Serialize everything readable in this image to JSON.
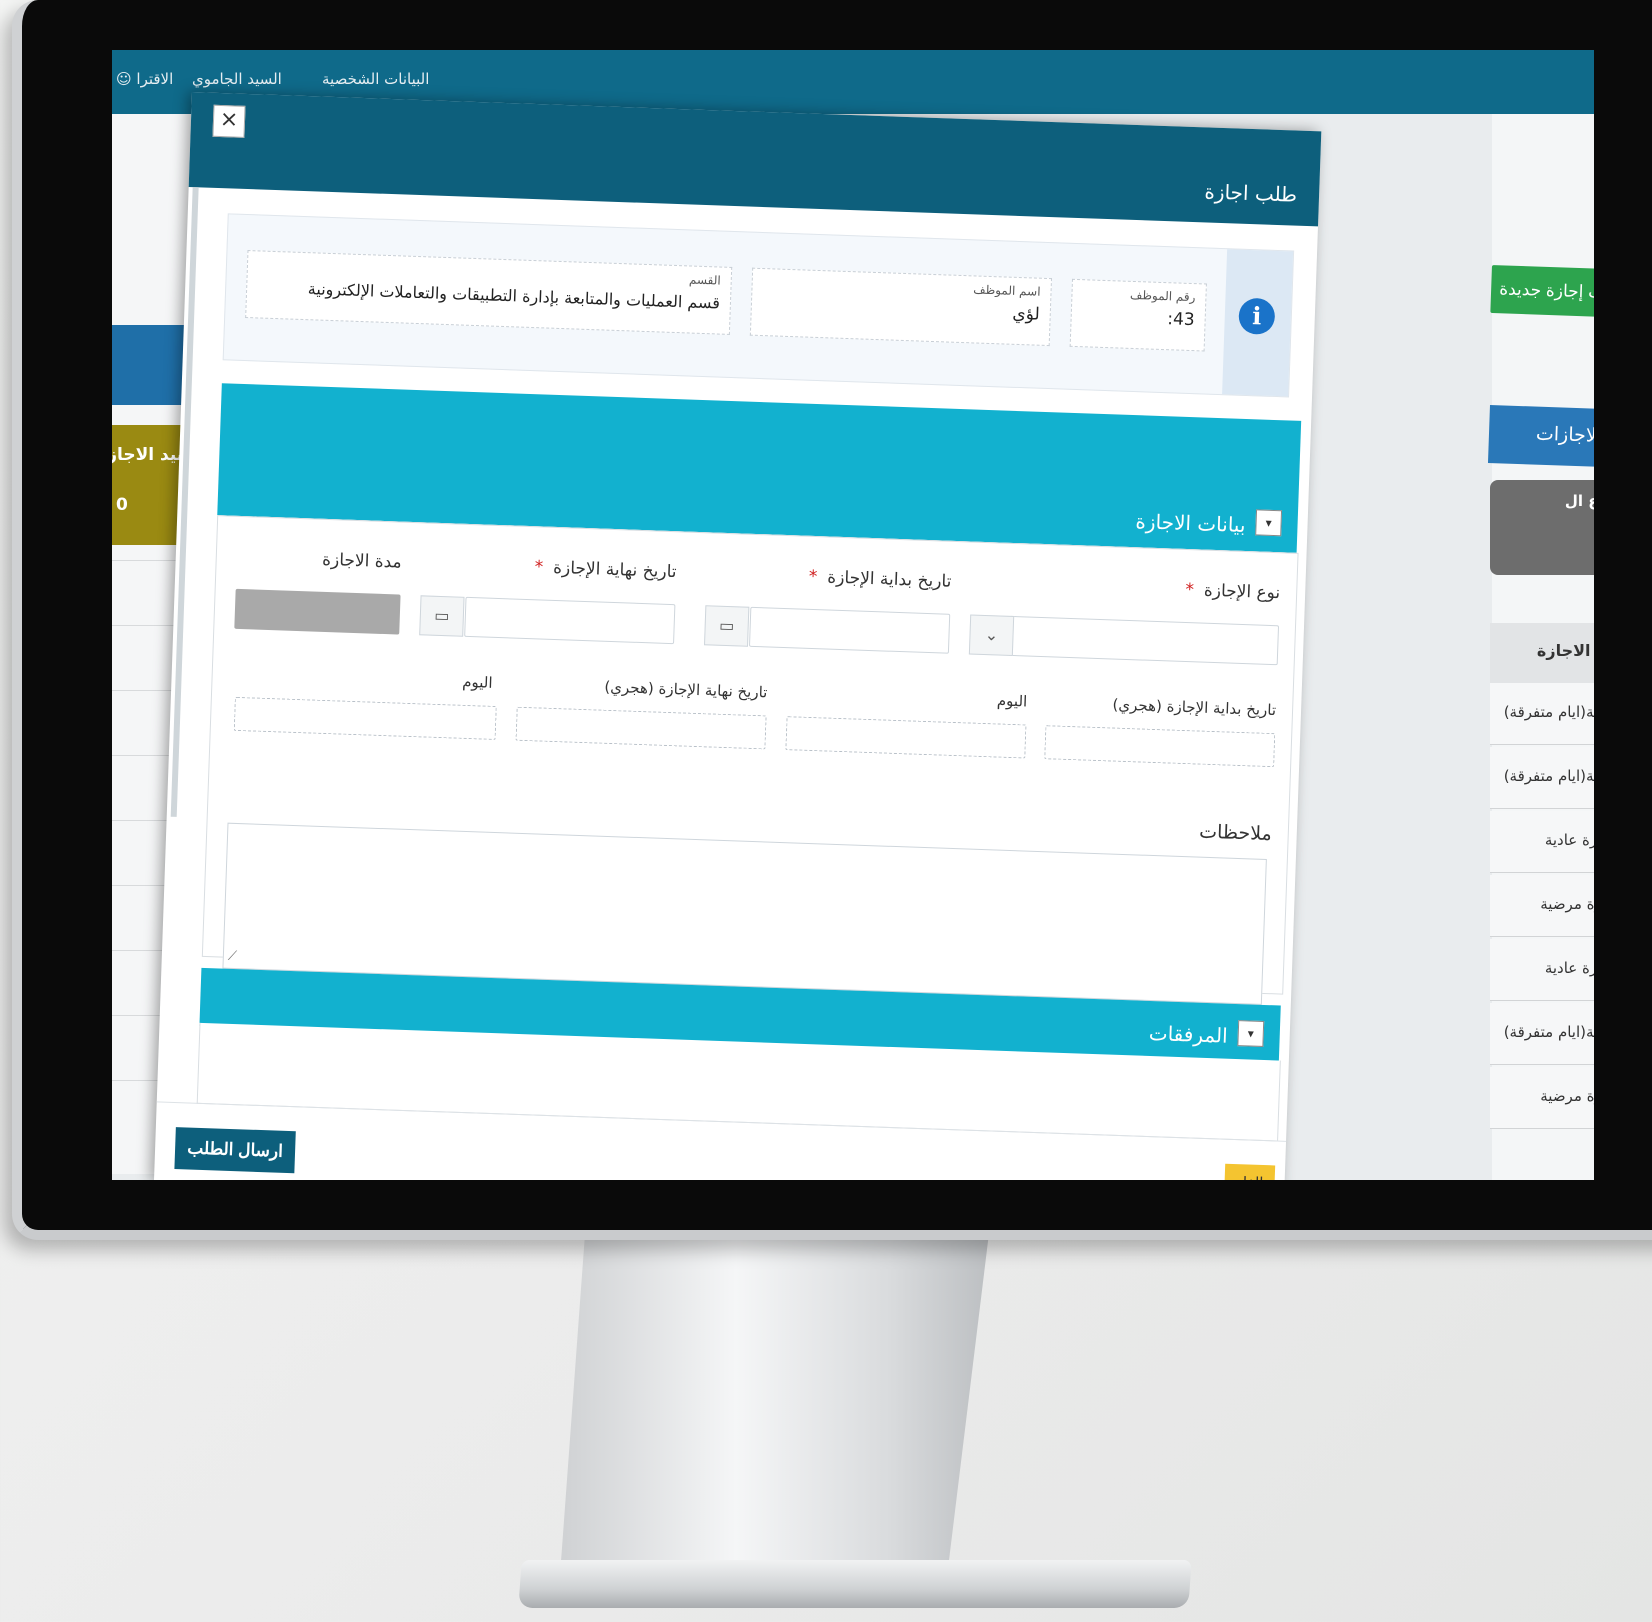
{
  "background_app": {
    "topbar": {
      "suggestions": "الاقترا",
      "user": "السيد الجاموي",
      "profile": "البيانات الشخصية"
    },
    "left_card": {
      "title": "رصيد الاجازة",
      "value": "0"
    },
    "new_leave_button": "طلب إجازة جديدة",
    "balance_header": "رصيد الاجازات",
    "balance_card": "مجموع ال",
    "table": {
      "header": "نوع الاجازة",
      "rows": [
        "إجازة عادية(ايام متفرقة)",
        "إجازة عادية(ايام متفرقة)",
        "إجازة عادية",
        "إجازة مرضية",
        "إجازة عادية",
        "إجازة عادية(ايام متفرقة)",
        "إجازة مرضية"
      ]
    }
  },
  "modal": {
    "title": "طلب اجازة",
    "close": "×",
    "employee": {
      "number_label": "رقم الموظف",
      "number_value": "43:",
      "name_label": "اسم الموظف",
      "name_value": "لؤي",
      "dept_label": "القسم",
      "dept_value": "قسم العمليات والمتابعة بإدارة التطبيقات والتعاملات الإلكترونية"
    },
    "leave_section": {
      "title": "بيانات الاجازة",
      "toggle": "▾",
      "type_label": "نوع الإجازة",
      "start_label": "تاريخ بداية الإجازة",
      "end_label": "تاريخ نهاية الإجازة",
      "duration_label": "مدة الاجازة",
      "start_hijri_label": "تاريخ بداية الإجازة (هجري)",
      "end_hijri_label": "تاريخ نهاية الإجازة (هجري)",
      "day_label_1": "اليوم",
      "day_label_2": "اليوم",
      "notes_label": "ملاحظات",
      "required_mark": "*"
    },
    "attachments": {
      "title": "المرفقات",
      "toggle": "▾"
    },
    "send_button": "ارسال الطلب",
    "cancel_button": "الغاء"
  },
  "colors": {
    "header": "#0d5f7c",
    "section": "#12b1cf",
    "send": "#0d5f7c",
    "cancel": "#f4c430",
    "new_leave": "#2da44e"
  }
}
